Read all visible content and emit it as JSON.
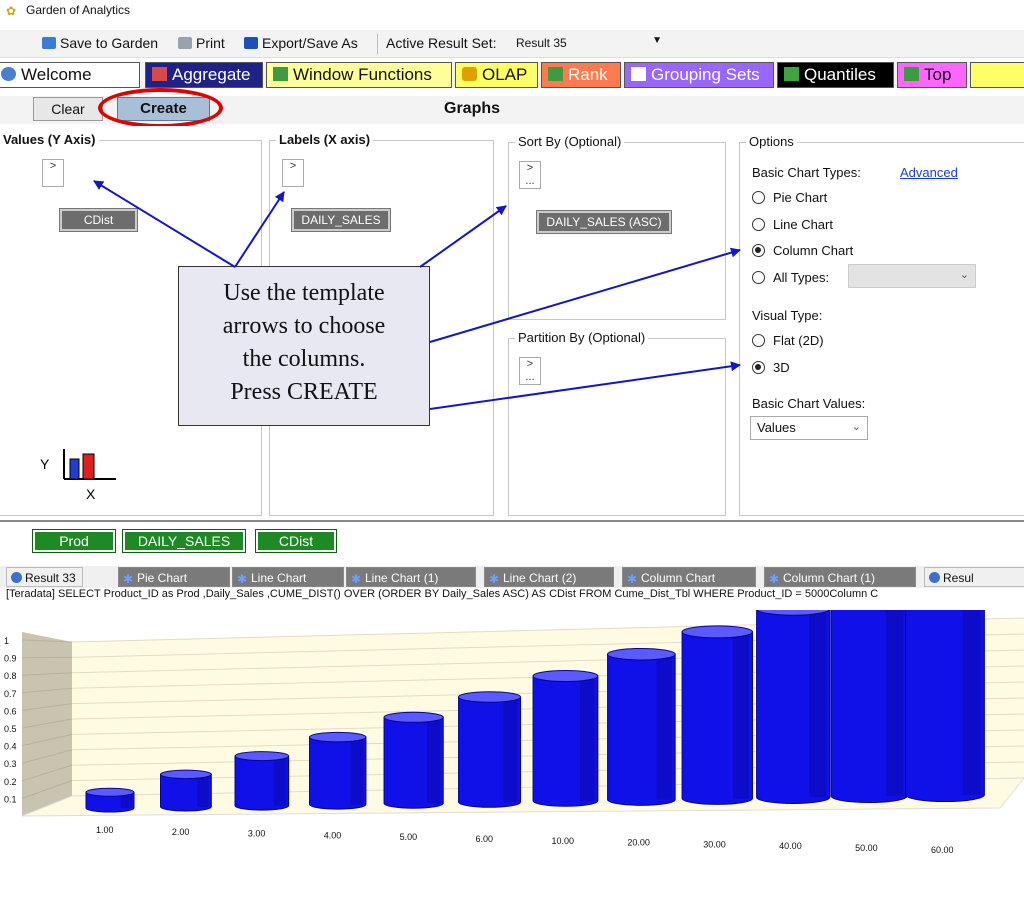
{
  "window": {
    "title": "Garden of Analytics"
  },
  "toolbar": {
    "save": "Save to Garden",
    "print": "Print",
    "export": "Export/Save As",
    "active_result_label": "Active Result Set:",
    "active_result_value": "Result 35"
  },
  "tabs": [
    {
      "label": "Welcome",
      "color": "#ffffff"
    },
    {
      "label": "Aggregate",
      "color": "#20208a"
    },
    {
      "label": "Window Functions",
      "color": "#ffff99"
    },
    {
      "label": "OLAP",
      "color": "#ffff66"
    },
    {
      "label": "Rank",
      "color": "#ff7a4d"
    },
    {
      "label": "Grouping Sets",
      "color": "#9966ff"
    },
    {
      "label": "Quantiles",
      "color": "#000000"
    },
    {
      "label": "Top",
      "color": "#ff66ff"
    }
  ],
  "graph_header": {
    "clear": "Clear",
    "create": "Create",
    "title": "Graphs"
  },
  "panels": {
    "values_label": "Values (Y Axis)",
    "values_chip": "CDist",
    "labels_label": "Labels (X axis)",
    "labels_chip": "DAILY_SALES",
    "sort_label": "Sort By (Optional)",
    "sort_chip": "DAILY_SALES (ASC)",
    "partition_label": "Partition By (Optional)",
    "picker_glyph": ">",
    "picker_dots": "..."
  },
  "options": {
    "label": "Options",
    "basic_chart_types": "Basic Chart Types:",
    "advanced": "Advanced",
    "pie": "Pie Chart",
    "line": "Line Chart",
    "column": "Column Chart",
    "all_types": "All Types:",
    "visual_type": "Visual Type:",
    "flat": "Flat (2D)",
    "three_d": "3D",
    "basic_chart_values": "Basic Chart Values:",
    "values_select": "Values"
  },
  "callout": {
    "line1": "Use the template",
    "line2": "arrows to choose",
    "line3": "the columns.",
    "line4": "Press CREATE"
  },
  "axis_icon": {
    "y": "Y",
    "x": "X"
  },
  "fields": [
    "Prod",
    "DAILY_SALES",
    "CDist"
  ],
  "result_tabs": [
    {
      "label": "Result 33",
      "active": true
    },
    {
      "label": "Pie Chart",
      "active": false
    },
    {
      "label": "Line Chart",
      "active": false
    },
    {
      "label": "Line Chart (1)",
      "active": false
    },
    {
      "label": "Line Chart (2)",
      "active": false
    },
    {
      "label": "Column Chart",
      "active": false
    },
    {
      "label": "Column Chart (1)",
      "active": false
    },
    {
      "label": "Resul",
      "active": true
    }
  ],
  "sql": "[Teradata] SELECT Product_ID as Prod ,Daily_Sales ,CUME_DIST() OVER (ORDER BY Daily_Sales ASC) AS CDist FROM Cume_Dist_Tbl WHERE Product_ID = 5000Column C",
  "colors": {
    "bar": "#1010e8",
    "bar_dark": "#05058f",
    "bar_top": "#5a5aff",
    "floor": "#fffbe2",
    "wall": "#c9c4b0"
  },
  "chart_data": {
    "type": "bar",
    "style": "3d-cylinder",
    "categories": [
      "1.00",
      "2.00",
      "3.00",
      "4.00",
      "5.00",
      "6.00",
      "10.00",
      "20.00",
      "30.00",
      "40.00",
      "50.00",
      "60.00"
    ],
    "series": [
      {
        "values": [
          0.083,
          0.167,
          0.25,
          0.333,
          0.417,
          0.5,
          0.583,
          0.667,
          0.75,
          0.833,
          0.917,
          1.0
        ]
      }
    ],
    "y_ticks": [
      "0.1",
      "0.2",
      "0.3",
      "0.4",
      "0.5",
      "0.6",
      "0.7",
      "0.8",
      "0.9",
      "1"
    ],
    "ylim": [
      0,
      1
    ],
    "grid": true,
    "legend": "none"
  }
}
